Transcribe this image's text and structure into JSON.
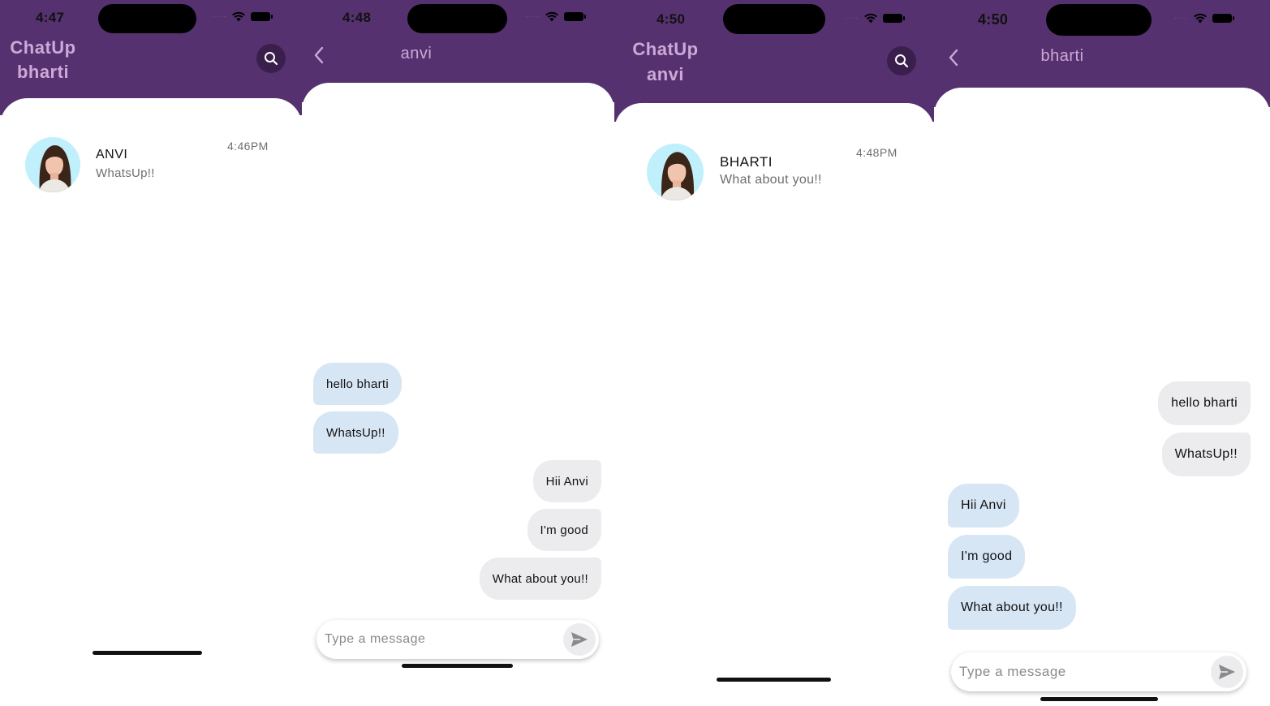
{
  "colors": {
    "header_bg": "#55326f",
    "title_text": "#cfa8d8",
    "received_bubble": "#d7e6f5",
    "sent_bubble": "#ececef",
    "search_button_bg": "#3a1f4d"
  },
  "screens": [
    {
      "status_time": "4:47",
      "app_name": "ChatUp",
      "user_name": "bharti",
      "search_icon": "search-icon",
      "chats": [
        {
          "name": "ANVI",
          "last_message": "WhatsUp!!",
          "time": "4:46PM"
        }
      ]
    },
    {
      "status_time": "4:48",
      "back_icon": "chevron-left-icon",
      "title": "anvi",
      "messages": [
        {
          "text": "hello bharti",
          "side": "left"
        },
        {
          "text": "WhatsUp!!",
          "side": "left"
        },
        {
          "text": "Hii Anvi",
          "side": "right"
        },
        {
          "text": "I'm good",
          "side": "right"
        },
        {
          "text": "What about you!!",
          "side": "right"
        }
      ],
      "input_placeholder": "Type a message",
      "send_icon": "send-icon"
    },
    {
      "status_time": "4:50",
      "app_name": "ChatUp",
      "user_name": "anvi",
      "search_icon": "search-icon",
      "chats": [
        {
          "name": "BHARTI",
          "last_message": "What about you!!",
          "time": "4:48PM"
        }
      ]
    },
    {
      "status_time": "4:50",
      "back_icon": "chevron-left-icon",
      "title": "bharti",
      "messages": [
        {
          "text": "hello bharti",
          "side": "right"
        },
        {
          "text": "WhatsUp!!",
          "side": "right"
        },
        {
          "text": "Hii Anvi",
          "side": "left"
        },
        {
          "text": "I'm good",
          "side": "left"
        },
        {
          "text": "What about you!!",
          "side": "left"
        }
      ],
      "input_placeholder": "Type a message",
      "send_icon": "send-icon"
    }
  ]
}
